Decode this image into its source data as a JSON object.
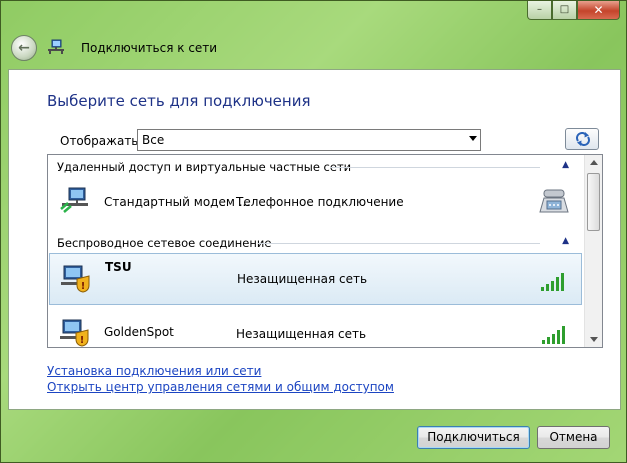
{
  "window": {
    "controls": {
      "minimize": "–",
      "maximize": "□",
      "close": "✕"
    }
  },
  "navbar": {
    "back_icon": "back-arrow-icon",
    "title": "Подключиться к сети"
  },
  "main": {
    "heading": "Выберите сеть для подключения",
    "show_label": "Отображать",
    "show_select": {
      "selected": "Все"
    }
  },
  "list": {
    "groups": [
      {
        "label": "Удаленный доступ и виртуальные частные сети",
        "items": [
          {
            "name": "Стандартный модем ...",
            "type": "Телефонное подключение",
            "right_icon": "telephone-icon"
          }
        ]
      },
      {
        "label": "Беспроводное сетевое соединение",
        "items": [
          {
            "name": "TSU",
            "type": "Незащищенная сеть",
            "right_icon": "signal-strength-icon",
            "selected": true
          },
          {
            "name": "GoldenSpot",
            "type": "Незащищенная сеть",
            "right_icon": "signal-strength-icon"
          }
        ]
      }
    ]
  },
  "links": {
    "setup": "Установка подключения или сети",
    "network_center": "Открыть центр управления сетями и общим доступом"
  },
  "buttons": {
    "connect": "Подключиться",
    "cancel": "Отмена"
  },
  "colors": {
    "heading": "#1e3287",
    "link": "#1c45c2",
    "selection": "#dbeaf5",
    "desktop": "#7cc24a"
  }
}
